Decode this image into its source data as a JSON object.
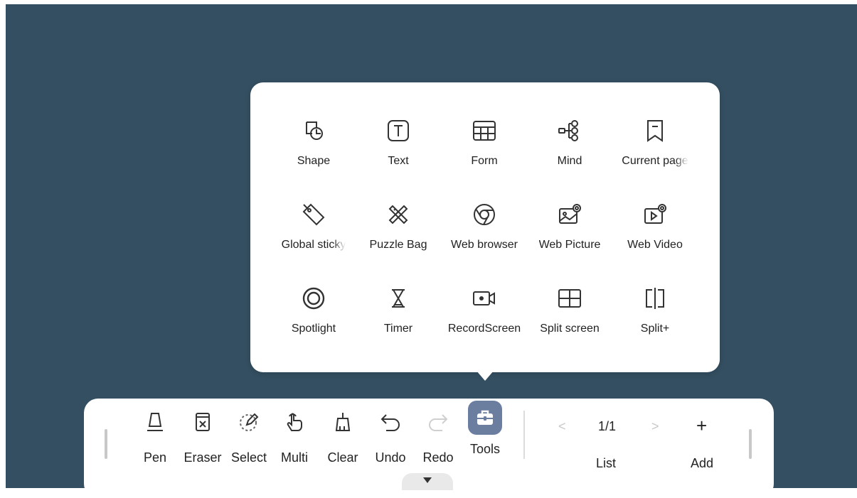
{
  "popup": {
    "tools": [
      {
        "label": "Shape",
        "icon": "shape-icon"
      },
      {
        "label": "Text",
        "icon": "text-icon"
      },
      {
        "label": "Form",
        "icon": "table-icon"
      },
      {
        "label": "Mind",
        "icon": "mindmap-icon"
      },
      {
        "label": "Current page",
        "icon": "bookmark-icon"
      },
      {
        "label": "Global sticky",
        "icon": "tag-icon"
      },
      {
        "label": "Puzzle Bag",
        "icon": "puzzle-ruler-icon"
      },
      {
        "label": "Web browser",
        "icon": "browser-icon"
      },
      {
        "label": "Web Picture",
        "icon": "web-picture-icon"
      },
      {
        "label": "Web Video",
        "icon": "web-video-icon"
      },
      {
        "label": "Spotlight",
        "icon": "spotlight-icon"
      },
      {
        "label": "Timer",
        "icon": "hourglass-icon"
      },
      {
        "label": "RecordScreen",
        "icon": "record-screen-icon"
      },
      {
        "label": "Split screen",
        "icon": "split-screen-icon"
      },
      {
        "label": "Split+",
        "icon": "split-plus-icon"
      }
    ]
  },
  "toolbar": {
    "pen": "Pen",
    "eraser": "Eraser",
    "select": "Select",
    "multi": "Multi",
    "clear": "Clear",
    "undo": "Undo",
    "redo": "Redo",
    "tools": "Tools",
    "list": "List",
    "add": "Add",
    "page_indicator": "1/1",
    "prev": "<",
    "next": ">",
    "add_symbol": "+"
  },
  "colors": {
    "background": "#344f61",
    "active_tool": "#6b7ea0",
    "panel": "#ffffff"
  }
}
